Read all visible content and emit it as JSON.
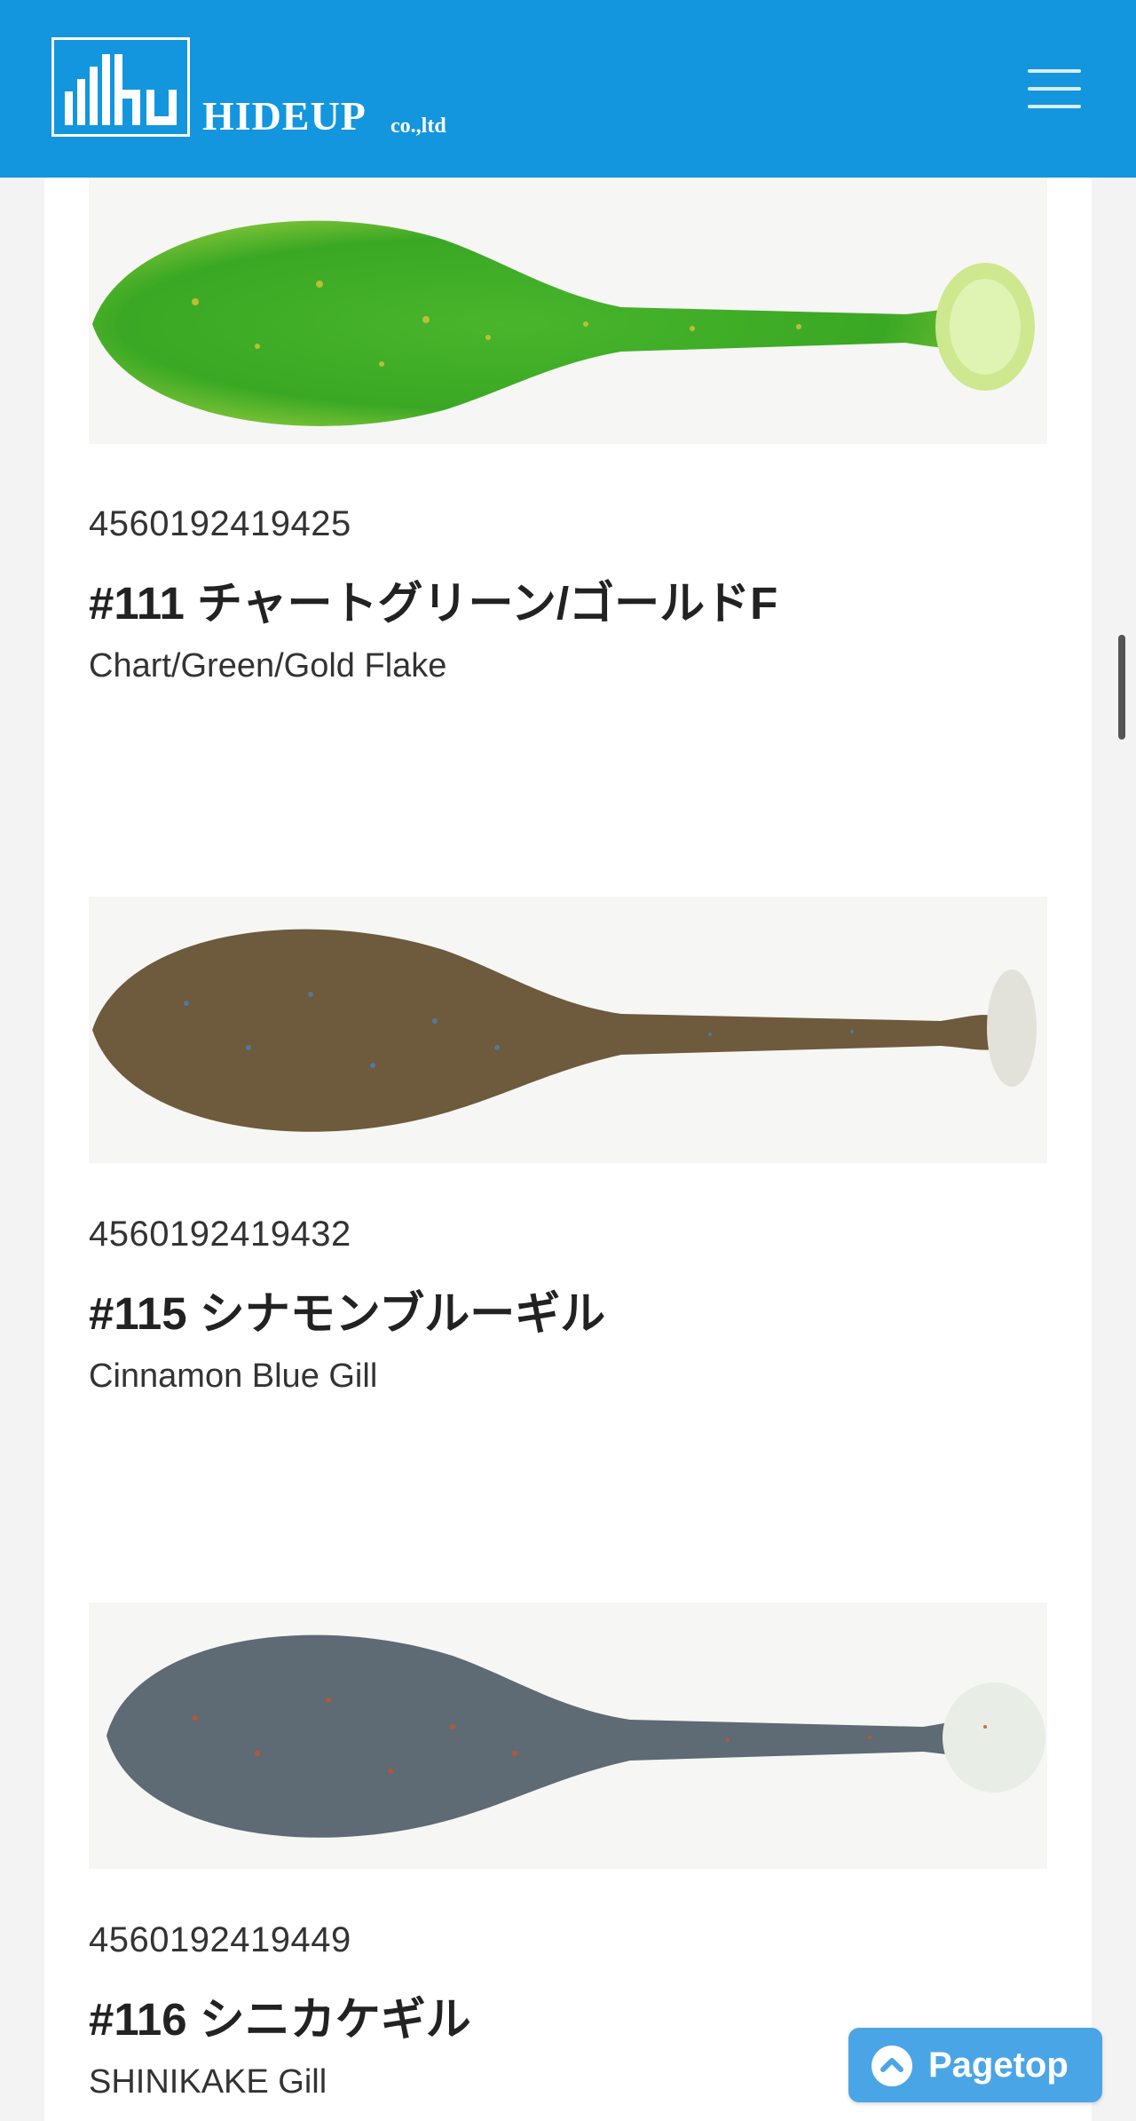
{
  "header": {
    "brand": "HIDEUP",
    "brand_suffix": "co.,ltd",
    "logo_icon": "hu-building-logo-icon",
    "menu_icon": "hamburger-menu-icon"
  },
  "products": [
    {
      "jan": "4560192419425",
      "title": "#111 チャートグリーン/ゴールドF",
      "subtitle": "Chart/Green/Gold Flake",
      "image_name": "lure-photo-chart-green"
    },
    {
      "jan": "4560192419432",
      "title": "#115 シナモンブルーギル",
      "subtitle": "Cinnamon Blue Gill",
      "image_name": "lure-photo-cinnamon-blue-gill"
    },
    {
      "jan": "4560192419449",
      "title": "#116 シニカケギル",
      "subtitle": "SHINIKAKE Gill",
      "image_name": "lure-photo-shinikake-gill"
    }
  ],
  "pagetop": {
    "label": "Pagetop",
    "icon": "chevron-up-icon"
  },
  "colors": {
    "header": "#1396dd",
    "pagetop": "#4aa5e6"
  }
}
